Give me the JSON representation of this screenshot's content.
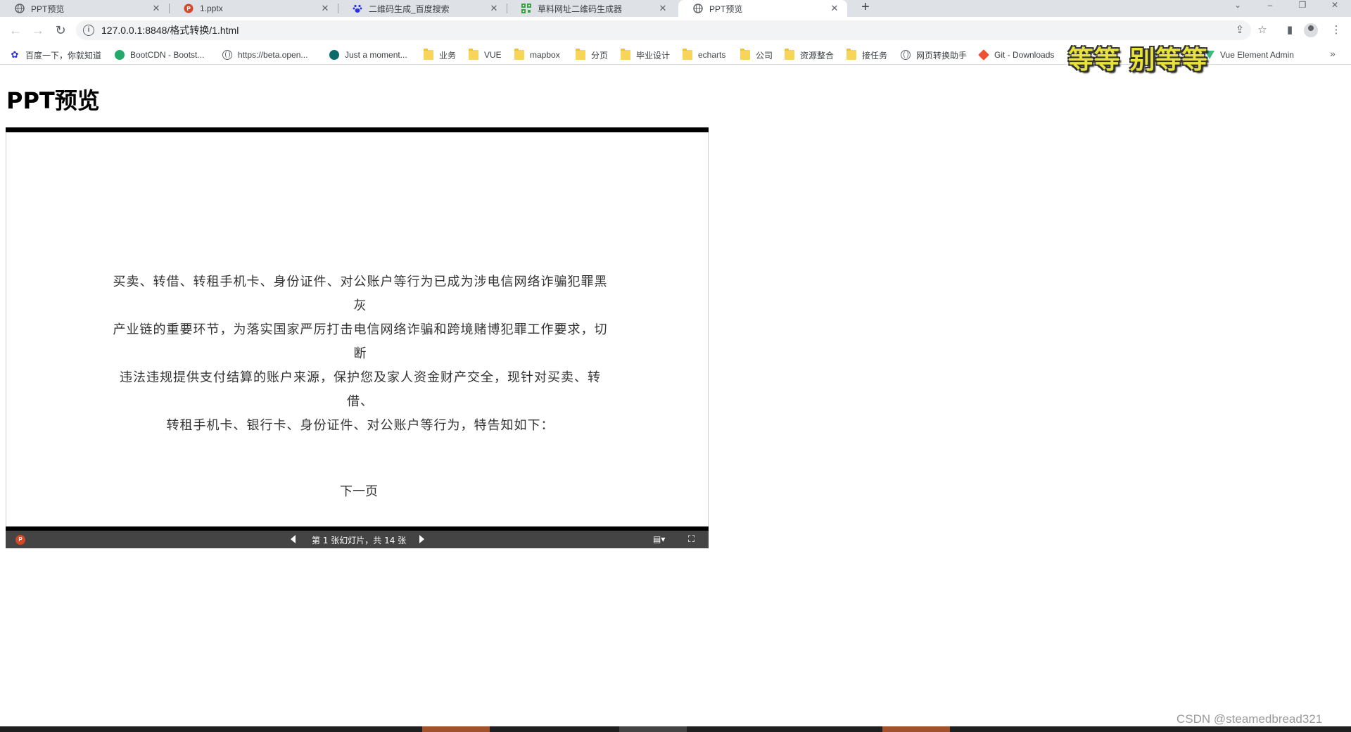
{
  "tabs": [
    {
      "title": "PPT预览",
      "icon": "globe-icon",
      "active": false
    },
    {
      "title": "1.pptx",
      "icon": "powerpoint-icon",
      "active": false
    },
    {
      "title": "二维码生成_百度搜索",
      "icon": "baidu-paw-icon",
      "active": false
    },
    {
      "title": "草料网址二维码生成器",
      "icon": "qr-icon",
      "active": false
    },
    {
      "title": "PPT预览",
      "icon": "globe-icon",
      "active": true
    }
  ],
  "toolbar": {
    "url": "127.0.0.1:8848/格式转换/1.html"
  },
  "bookmarks": [
    {
      "label": "百度一下，你就知道",
      "icon": "baidu-paw-icon"
    },
    {
      "label": "BootCDN - Bootst...",
      "icon": "bootcdn-icon"
    },
    {
      "label": "https://beta.open...",
      "icon": "globe-icon"
    },
    {
      "label": "Just a moment...",
      "icon": "cloudflare-icon"
    },
    {
      "label": "业务",
      "icon": "folder-icon"
    },
    {
      "label": "VUE",
      "icon": "folder-icon"
    },
    {
      "label": "mapbox",
      "icon": "folder-icon"
    },
    {
      "label": "分页",
      "icon": "folder-icon"
    },
    {
      "label": "毕业设计",
      "icon": "folder-icon"
    },
    {
      "label": "echarts",
      "icon": "folder-icon"
    },
    {
      "label": "公司",
      "icon": "folder-icon"
    },
    {
      "label": "资源整合",
      "icon": "folder-icon"
    },
    {
      "label": "接任务",
      "icon": "folder-icon"
    },
    {
      "label": "网页转换助手",
      "icon": "globe-icon"
    },
    {
      "label": "Git - Downloads",
      "icon": "git-icon"
    },
    {
      "label": "Vue Element Admin",
      "icon": "vue-icon"
    }
  ],
  "overlay": {
    "text": "等等 别等等"
  },
  "page": {
    "title": "PPT预览"
  },
  "slide": {
    "lines": [
      "买卖、转借、转租手机卡、身份证件、对公账户等行为已成为涉电信网络诈骗犯罪黑灰",
      "产业链的重要环节，为落实国家严厉打击电信网络诈骗和跨境赌博犯罪工作要求，切断",
      "违法违规提供支付结算的账户来源，保护您及家人资金财产交全，现针对买卖、转借、",
      "转租手机卡、银行卡、身份证件、对公账户等行为，特告知如下："
    ],
    "next_link": "下一页"
  },
  "viewer_status": {
    "counter": "第 1 张幻灯片，共 14 张"
  },
  "watermark": "CSDN @steamedbread321",
  "colors": {
    "tabstrip_bg": "#dee1e6",
    "viewer_bar": "#444444",
    "overlay_text": "#e8e33a",
    "powerpoint_red": "#d24726"
  }
}
